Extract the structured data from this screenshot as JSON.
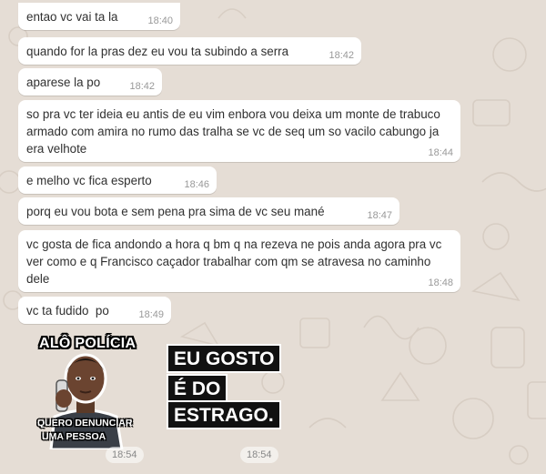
{
  "colors": {
    "wallpaper": "#e5ddd5",
    "bubble": "#ffffff",
    "timestamp": "#999999",
    "sticker_black": "#111111"
  },
  "messages": [
    {
      "text": "entao vc vai ta la",
      "time": "18:40"
    },
    {
      "text": "quando for la pras dez eu vou ta subindo a serra",
      "time": "18:42"
    },
    {
      "text": "aparese la po",
      "time": "18:42"
    },
    {
      "text": "so pra vc ter ideia eu antis de eu vim enbora vou deixa um monte de trabuco armado com amira no rumo das tralha se vc de seq um so vacilo cabungo ja era velhote",
      "time": "18:44"
    },
    {
      "text": "e melho vc fica esperto",
      "time": "18:46"
    },
    {
      "text": "porq eu vou bota e sem pena pra sima de vc seu mané",
      "time": "18:47"
    },
    {
      "text": "vc gosta de fica andondo a hora q bm q na rezeva ne pois anda agora pra vc ver como e q Francisco caçador trabalhar com qm se atravesa no caminho dele",
      "time": "18:48"
    },
    {
      "text": "vc ta fudido  po",
      "time": "18:49"
    }
  ],
  "stickers": [
    {
      "name": "alo-policia-sticker",
      "top_text": "ALÔ POLÍCIA",
      "bottom_line1": "QUERO DENUNCIAR",
      "bottom_line2": "UMA PESSOA",
      "time": "18:54"
    },
    {
      "name": "eu-gosto-do-estrago-sticker",
      "line1": "EU GOSTO",
      "line2": "É DO",
      "line3": "ESTRAGO.",
      "time": "18:54"
    }
  ]
}
